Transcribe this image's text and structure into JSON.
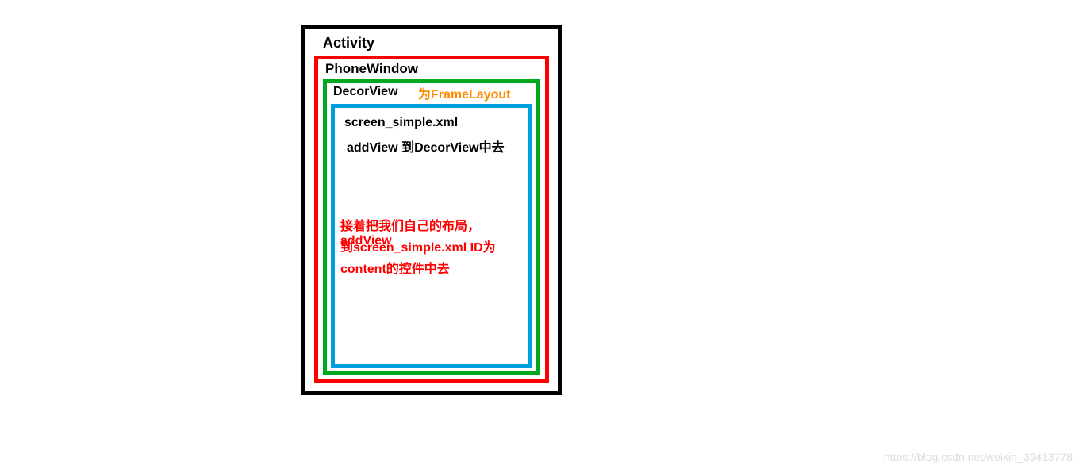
{
  "boxes": {
    "activity": {
      "label": "Activity"
    },
    "phoneWindow": {
      "label": "PhoneWindow"
    },
    "decorView": {
      "label": "DecorView",
      "annotation": "为FrameLayout"
    },
    "screenSimple": {
      "line1": "screen_simple.xml",
      "line2": "addView 到DecorView中去",
      "redLine1": "接着把我们自己的布局，addView",
      "redLine2": "到screen_simple.xml ID为",
      "redLine3": "content的控件中去"
    }
  },
  "watermark": "https://blog.csdn.net/weixin_39413778"
}
